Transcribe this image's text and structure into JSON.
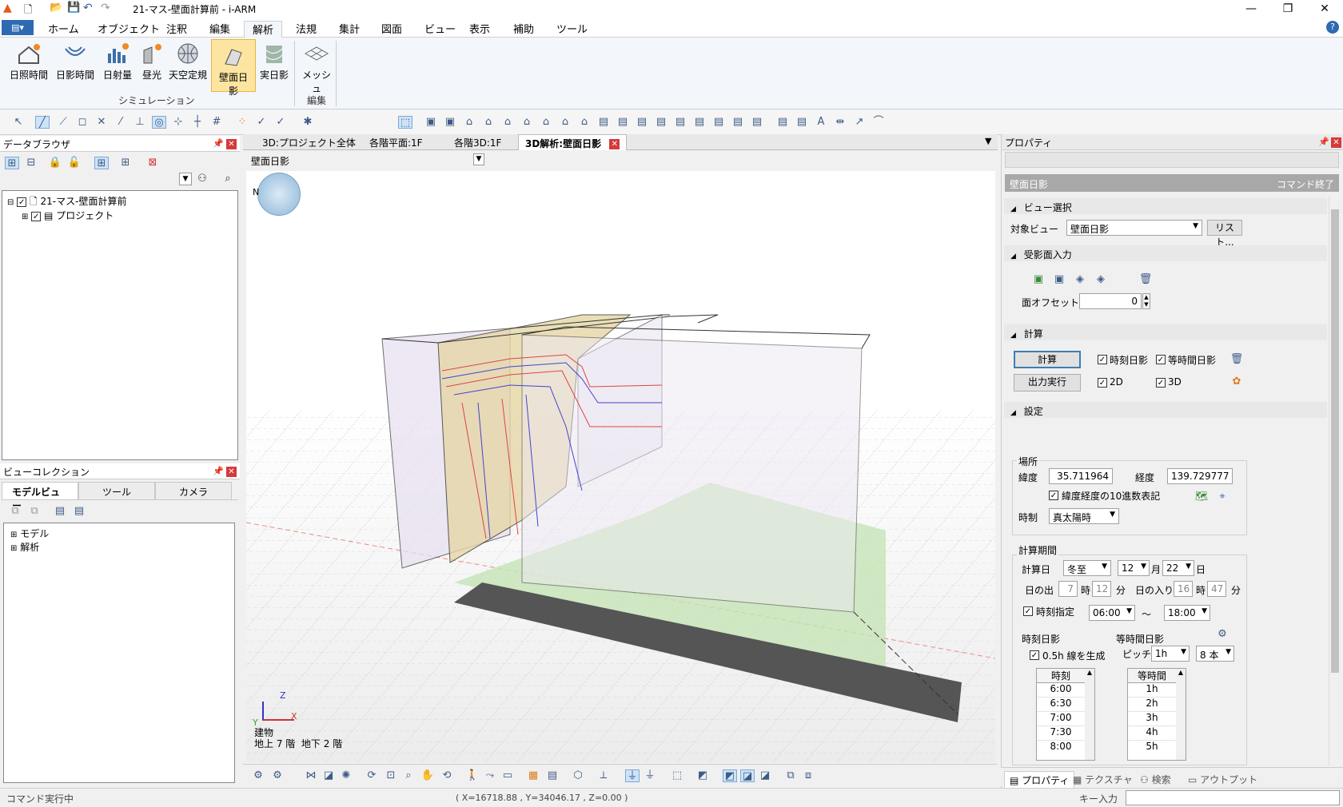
{
  "window": {
    "title": "21-マス-壁面計算前 - i-ARM",
    "minimize": "—",
    "maximize": "❐",
    "close": "✕"
  },
  "menu": {
    "tabs": [
      "ホーム",
      "オブジェクト",
      "注釈",
      "編集",
      "解析",
      "法規",
      "集計",
      "図面",
      "ビュー",
      "表示",
      "補助",
      "ツール"
    ],
    "active": "解析",
    "help": "?"
  },
  "ribbon": {
    "buttons": [
      {
        "label": "日照時間",
        "icon": "house-sun-icon"
      },
      {
        "label": "日影時間",
        "icon": "shadow-time-icon"
      },
      {
        "label": "日射量",
        "icon": "solar-radiation-icon"
      },
      {
        "label": "昼光",
        "icon": "daylight-icon"
      },
      {
        "label": "天空定規",
        "icon": "sky-globe-icon"
      },
      {
        "label": "壁面日影",
        "icon": "wall-shadow-icon"
      },
      {
        "label": "実日影",
        "icon": "real-shadow-icon"
      },
      {
        "label": "メッシュ",
        "icon": "mesh-icon"
      }
    ],
    "group_simulation": "シミュレーション",
    "group_edit": "編集"
  },
  "data_browser": {
    "title": "データブラウザ",
    "tree": [
      {
        "label": "21-マス-壁面計算前"
      },
      {
        "label": "プロジェクト"
      }
    ]
  },
  "view_collection": {
    "title": "ビューコレクション",
    "tabs": [
      "モデルビュー",
      "ツール",
      "カメラ"
    ],
    "tree": [
      "モデル",
      "解析"
    ]
  },
  "doc_tabs": [
    "3D:プロジェクト全体",
    "各階平面:1F",
    "各階3D:1F",
    "3D解析:壁面日影"
  ],
  "view_select": "壁面日影",
  "viewport": {
    "north": "N",
    "building_label": "建物",
    "floors": "地上 7 階  地下 2 階",
    "axis_x": "X",
    "axis_y": "Y",
    "axis_z": "Z"
  },
  "properties": {
    "title": "プロパティ",
    "header": "壁面日影",
    "end_command": "コマンド終了",
    "view_select_section": "ビュー選択",
    "target_view_label": "対象ビュー",
    "target_view_value": "壁面日影",
    "list_button": "リスト...",
    "receiving_section": "受影面入力",
    "offset_label": "面オフセット",
    "offset_value": "0",
    "calc_section": "計算",
    "calc_button": "計算",
    "output_button": "出力実行",
    "chk_time_shadow": "時刻日影",
    "chk_equal_time": "等時間日影",
    "chk_2d": "2D",
    "chk_3d": "3D",
    "settings_section": "設定",
    "place_label": "場所",
    "lat_label": "緯度",
    "lat_value": "35.711964",
    "lon_label": "経度",
    "lon_value": "139.729777",
    "decimal_label": "緯度経度の10進数表記",
    "time_label": "時制",
    "time_value": "真太陽時",
    "period_label": "計算期間",
    "calc_day_label": "計算日",
    "calc_day_value": "冬至",
    "month_value": "12",
    "month_unit": "月",
    "day_value": "22",
    "day_unit": "日",
    "sunrise_label": "日の出",
    "sunrise_h": "7",
    "hour_unit": "時",
    "sunrise_m": "12",
    "min_unit": "分",
    "sunset_label": "日の入り",
    "sunset_h": "16",
    "sunset_m": "47",
    "time_spec_label": "時刻指定",
    "time_from": "06:00",
    "tilde": "〜",
    "time_to": "18:00",
    "time_shadow_label": "時刻日影",
    "equal_shadow_label": "等時間日影",
    "half_hour_label": "0.5h 線を生成",
    "pitch_label": "ピッチ",
    "pitch_value": "1h",
    "lines_value": "8 本",
    "times_header": "時刻",
    "times": [
      "6:00",
      "6:30",
      "7:00",
      "7:30",
      "8:00"
    ],
    "equal_header": "等時間",
    "equal_times": [
      "1h",
      "2h",
      "3h",
      "4h",
      "5h"
    ]
  },
  "bottom_tabs": [
    "プロパティ",
    "テクスチャ",
    "検索",
    "アウトプット"
  ],
  "status": {
    "left": "コマンド実行中",
    "coords": "( X=16718.88 , Y=34046.17 , Z=0.00 )",
    "key_input": "キー入力"
  }
}
